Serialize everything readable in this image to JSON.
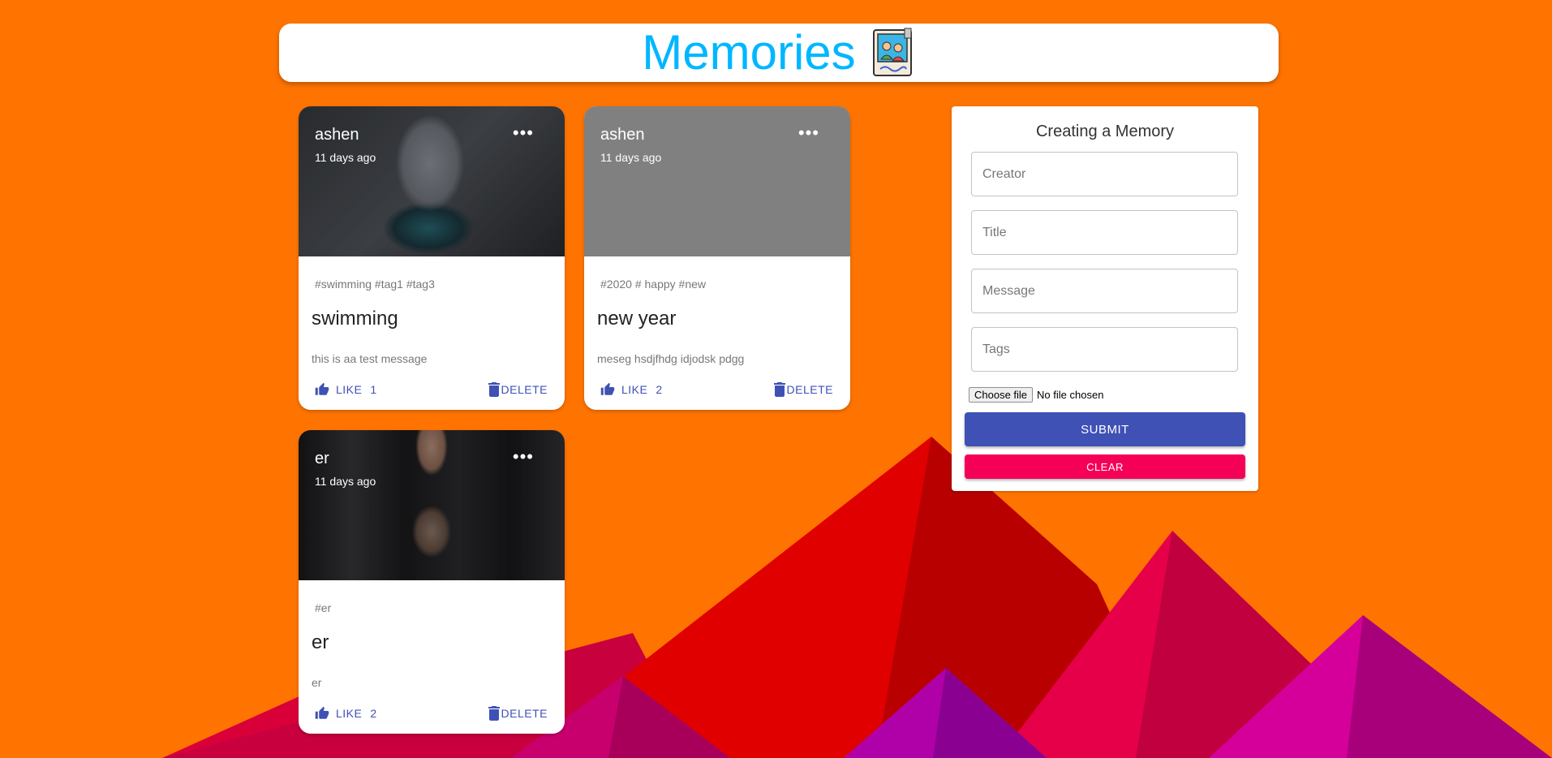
{
  "app": {
    "title": "Memories",
    "logo_icon": "photo-album-icon"
  },
  "colors": {
    "background": "#ff7300",
    "title": "#00b7ff",
    "primary": "#3f51b5",
    "secondary": "#f50057"
  },
  "posts": [
    {
      "creator": "ashen",
      "time": "11 days ago",
      "tags": "#swimming #tag1 #tag3",
      "title": "swimming",
      "message": "this is aa test message",
      "like_label": "LIKE",
      "likes": "1",
      "delete_label": "DELETE",
      "image": "robot-portrait"
    },
    {
      "creator": "ashen",
      "time": "11 days ago",
      "tags": "#2020 # happy #new",
      "title": "new year",
      "message": "meseg hsdjfhdg idjodsk pdgg",
      "like_label": "LIKE",
      "likes": "2",
      "delete_label": "DELETE",
      "image": "none"
    },
    {
      "creator": "er",
      "time": "11 days ago",
      "tags": "#er",
      "title": "er",
      "message": "er",
      "like_label": "LIKE",
      "likes": "2",
      "delete_label": "DELETE",
      "image": "man-in-leather-jacket"
    }
  ],
  "form": {
    "heading": "Creating a Memory",
    "creator_placeholder": "Creator",
    "title_placeholder": "Title",
    "message_placeholder": "Message",
    "tags_placeholder": "Tags",
    "file_button": "Choose file",
    "file_status": "No file chosen",
    "submit_label": "SUBMIT",
    "clear_label": "CLEAR"
  }
}
